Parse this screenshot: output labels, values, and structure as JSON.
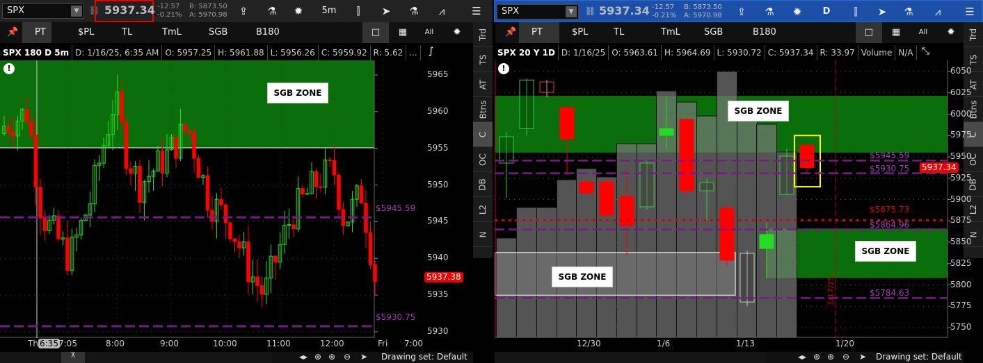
{
  "left": {
    "symbol": "SPX",
    "last_price": "5937.34",
    "change": "-12.57",
    "change_pct": "-0.21%",
    "bid": "B: 5873.50",
    "ask": "A: 5970.98",
    "timeframe_button": "5m",
    "tools": {
      "pin": "",
      "pt": "PT",
      "pl": "$PL",
      "tl": "TL",
      "tml": "TmL",
      "sgb": "SGB",
      "b180": "B180",
      "all": "All"
    },
    "info": [
      "SPX 180 D 5m",
      "D: 1/16/25, 6:35 AM",
      "O: 5957.25",
      "H: 5961.88",
      "L: 5956.26",
      "C: 5959.92",
      "R: 5.62",
      "..."
    ],
    "price_axis": [
      "5965",
      "5960",
      "5955",
      "5950",
      "5945",
      "5940",
      "5935",
      "5930"
    ],
    "time_axis": [
      "Th",
      "6:35",
      "7:05",
      "8:00",
      "9:00",
      "10:00",
      "11:00",
      "12:00",
      "Fri",
      "7:00"
    ],
    "zone_label": "SGB ZONE",
    "level_labels": [
      "$5945.59",
      "$5930.75"
    ],
    "current_tag": "5937.38",
    "drawing_set": "Drawing set: Default"
  },
  "right": {
    "symbol": "SPX",
    "last_price": "5937.34",
    "change": "-12.57",
    "change_pct": "-0.21%",
    "bid": "B: 5873.50",
    "ask": "A: 5970.98",
    "timeframe_button": "D",
    "tools": {
      "pt": "PT",
      "pl": "$PL",
      "tl": "TL",
      "tml": "TmL",
      "sgb": "SGB",
      "b180": "B180",
      "all": "All"
    },
    "info": [
      "SPX 20 Y 1D",
      "D: 1/16/25",
      "O: 5963.61",
      "H: 5964.69",
      "L: 5930.72",
      "C: 5937.34",
      "R: 33.97",
      "Volume",
      "N/A"
    ],
    "price_axis": [
      "6050",
      "6025",
      "6000",
      "5975",
      "5950",
      "5925",
      "5900",
      "5875",
      "5850",
      "5825",
      "5800",
      "5775",
      "5750"
    ],
    "time_axis": [
      "12/30",
      "1/6",
      "1/13",
      "1/20"
    ],
    "zone_labels": [
      "SGB ZONE",
      "SGB ZONE",
      "SGB ZONE"
    ],
    "level_labels": [
      "$5945.59",
      "$5930.75",
      "$5875.73",
      "$5864.96",
      "$5784.63"
    ],
    "vertical_date": "1/17/25",
    "current_tag": "5937.34",
    "drawing_set": "Drawing set: Default",
    "candles": [
      {
        "o": 5942.7,
        "h": 5979,
        "l": 5902,
        "c": 5973.6,
        "style": "hollow-green",
        "vol": 0.36
      },
      {
        "o": 5983,
        "h": 6042,
        "l": 5975,
        "c": 6040,
        "style": "hollow-green",
        "vol": 0.47
      },
      {
        "o": 6025.6,
        "h": 6040,
        "l": 6020,
        "c": 6037.8,
        "style": "hollow-red",
        "vol": 0.47
      },
      {
        "o": 6007.7,
        "h": 6010,
        "l": 5930,
        "c": 5971,
        "style": "red",
        "vol": 0.57
      },
      {
        "o": 5920.7,
        "h": 5922,
        "l": 5905,
        "c": 5907.7,
        "style": "red",
        "vol": 0.61
      },
      {
        "o": 5920.7,
        "h": 5925,
        "l": 5880,
        "c": 5881.7,
        "style": "red",
        "vol": 0.58
      },
      {
        "o": 5903.7,
        "h": 5935,
        "l": 5834.6,
        "c": 5869.5,
        "style": "red",
        "vol": 0.7
      },
      {
        "o": 5891.5,
        "h": 5945,
        "l": 5888,
        "c": 5942.7,
        "style": "hollow-green",
        "vol": 0.7
      },
      {
        "o": 5975.2,
        "h": 6021.5,
        "l": 5958.9,
        "c": 5983,
        "style": "green",
        "vol": 0.89
      },
      {
        "o": 5993.9,
        "h": 5995,
        "l": 5905,
        "c": 5910.2,
        "style": "red",
        "vol": 0.85
      },
      {
        "o": 5910.2,
        "h": 5925,
        "l": 5876,
        "c": 5919.9,
        "style": "hollow-green",
        "vol": 0.8
      },
      {
        "o": 5889.8,
        "h": 5893,
        "l": 5822,
        "c": 5828.9,
        "style": "red",
        "vol": 0.96
      },
      {
        "o": 5780,
        "h": 5840,
        "l": 5775,
        "c": 5837,
        "style": "hollow-gray",
        "vol": 0.8
      },
      {
        "o": 5842.7,
        "h": 5873.6,
        "l": 5808.5,
        "c": 5859,
        "style": "green",
        "vol": 0.77
      },
      {
        "o": 5906,
        "h": 5960,
        "l": 5905,
        "c": 5950.8,
        "style": "hollow-green",
        "vol": 0.67
      },
      {
        "o": 5963.61,
        "h": 5964.69,
        "l": 5930.72,
        "c": 5937.34,
        "style": "red",
        "vol": 0
      }
    ]
  },
  "side_tabs": [
    "Trd",
    "TS",
    "AT",
    "Btns",
    "C",
    "OC",
    "DB",
    "L2",
    "N"
  ],
  "colors": {
    "zone": "#0a6e0a",
    "up": "#22dd22",
    "down": "#ff0000",
    "level": "#7a1a8a",
    "highlight": "#e00000"
  }
}
